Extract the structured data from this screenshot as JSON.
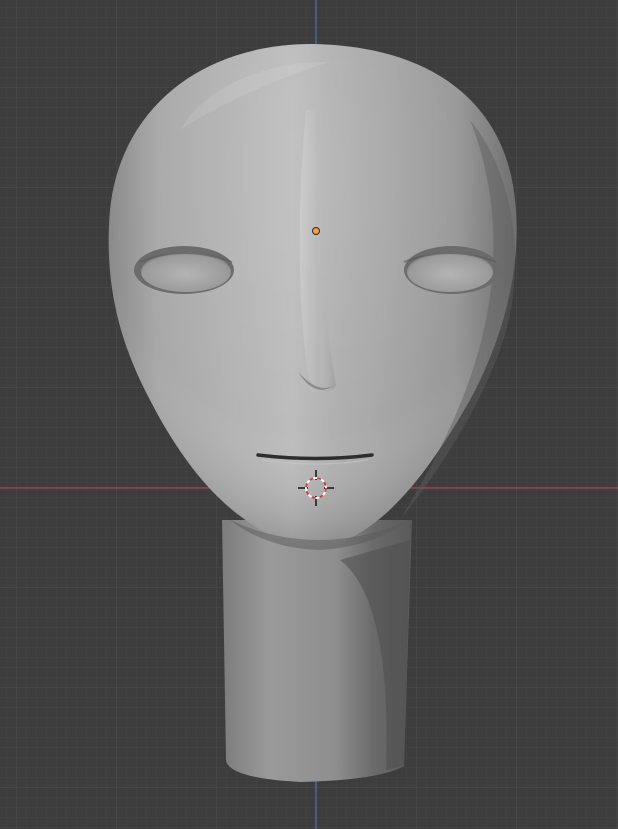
{
  "viewport": {
    "background_color": "#3d3d3d",
    "grid_minor_color": "#454545",
    "grid_major_color": "#4f4f4f",
    "x_axis_color": "#9c3f48",
    "z_axis_color": "#4a6aa6",
    "origin_color": "#f2a03a",
    "cursor_ring_colors": [
      "#d04040",
      "#ffffff"
    ]
  },
  "scene": {
    "object": "head-mesh",
    "shading": "solid-gray",
    "icons": [
      "object-origin-icon",
      "3d-cursor-icon"
    ]
  }
}
